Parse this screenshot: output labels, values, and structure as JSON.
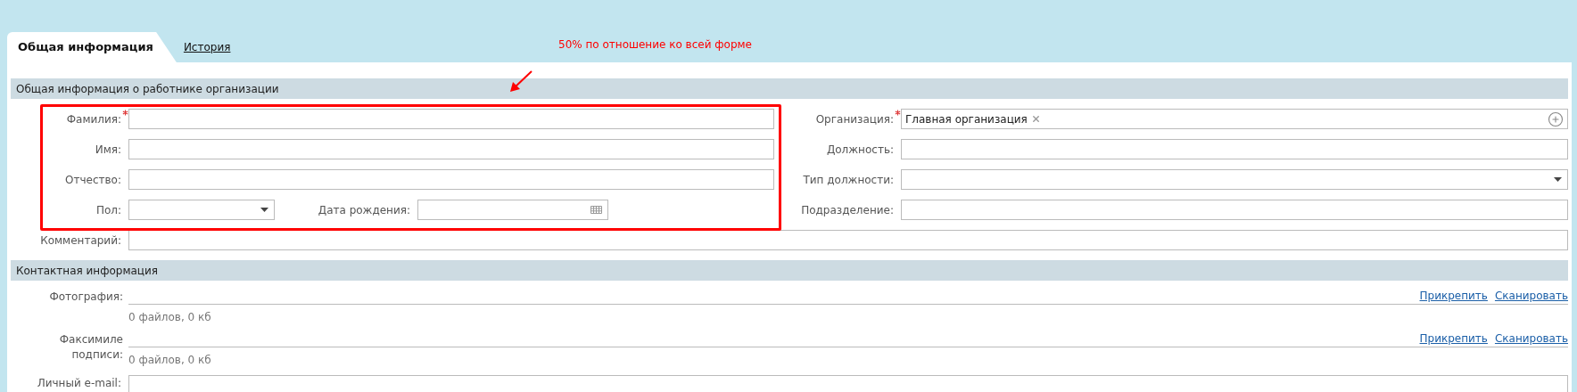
{
  "tabs": [
    {
      "label": "Общая информация",
      "selected": true
    },
    {
      "label": "История",
      "selected": false
    }
  ],
  "annotation": {
    "text": "50% по отношение ко всей форме"
  },
  "general": {
    "title": "Общая информация о работнике организации",
    "left_fields": [
      {
        "label": "Фамилия:",
        "required": true,
        "kind": "text"
      },
      {
        "label": "Имя:",
        "required": false,
        "kind": "text"
      },
      {
        "label": "Отчество:",
        "required": false,
        "kind": "text"
      }
    ],
    "gender": {
      "label": "Пол:",
      "kind": "select"
    },
    "birth_date": {
      "label": "Дата рождения:",
      "kind": "date"
    },
    "right_fields": [
      {
        "label": "Организация:",
        "required": true,
        "kind": "tags",
        "tags": [
          "Главная организация"
        ]
      },
      {
        "label": "Должность:",
        "required": false,
        "kind": "text"
      },
      {
        "label": "Тип должности:",
        "required": false,
        "kind": "select"
      },
      {
        "label": "Подразделение:",
        "required": false,
        "kind": "text"
      }
    ],
    "comment": {
      "label": "Комментарий:"
    }
  },
  "contacts": {
    "title": "Контактная информация",
    "attachments": [
      {
        "label": "Фотография:",
        "info": "0 файлов, 0 кб",
        "links": [
          "Прикрепить",
          "Сканировать"
        ]
      },
      {
        "label": "Факсимиле подписи:",
        "info": "0 файлов, 0 кб",
        "links": [
          "Прикрепить",
          "Сканировать"
        ]
      }
    ],
    "email": {
      "label": "Личный e-mail:"
    }
  }
}
